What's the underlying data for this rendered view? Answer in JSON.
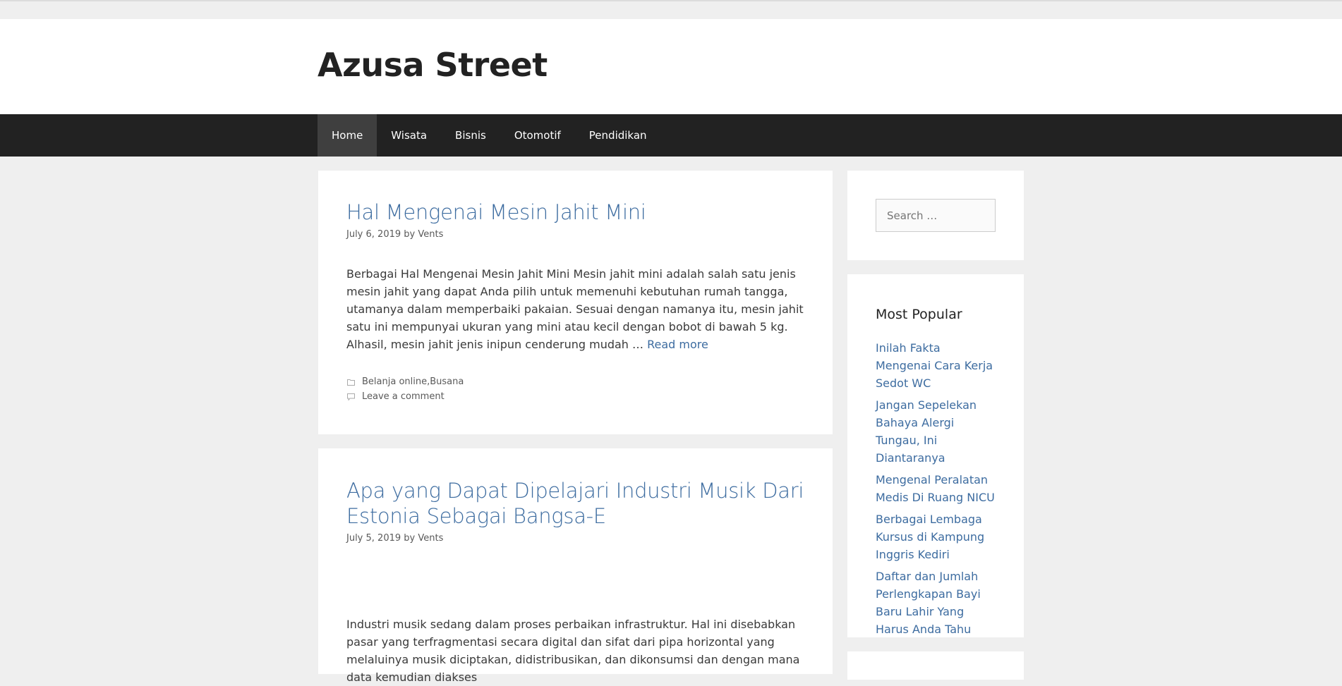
{
  "site": {
    "title": "Azusa Street"
  },
  "nav": {
    "items": [
      {
        "label": "Home"
      },
      {
        "label": "Wisata"
      },
      {
        "label": "Bisnis"
      },
      {
        "label": "Otomotif"
      },
      {
        "label": "Pendidikan"
      }
    ]
  },
  "posts": [
    {
      "title": "Hal Mengenai Mesin Jahit Mini",
      "date": "July 6, 2019",
      "by": "by",
      "author": "Vents",
      "summary": "Berbagai Hal Mengenai Mesin Jahit Mini Mesin jahit mini adalah salah satu jenis mesin jahit yang dapat Anda pilih untuk memenuhi kebutuhan rumah tangga, utamanya dalam memperbaiki pakaian. Sesuai dengan namanya itu, mesin jahit satu ini mempunyai ukuran yang mini atau kecil dengan bobot di bawah 5 kg. Alhasil, mesin jahit jenis inipun cenderung mudah …",
      "read_more": "Read more",
      "categories": [
        "Belanja online",
        "Busana"
      ],
      "category_separator": ", ",
      "comment_link": "Leave a comment"
    },
    {
      "title": "Apa yang Dapat Dipelajari Industri Musik Dari Estonia Sebagai Bangsa-E",
      "date": "July 5, 2019",
      "by": "by",
      "author": "Vents",
      "summary": "Industri musik sedang dalam proses perbaikan infrastruktur. Hal ini disebabkan pasar yang terfragmentasi secara digital dan sifat dari pipa horizontal yang melaluinya musik diciptakan, didistribusikan, dan dikonsumsi dan dengan mana data kemudian diakses"
    }
  ],
  "sidebar": {
    "search": {
      "placeholder": "Search …"
    },
    "popular": {
      "title": "Most Popular",
      "items": [
        "Inilah Fakta Mengenai Cara Kerja Sedot WC",
        "Jangan Sepelekan Bahaya Alergi Tungau, Ini Diantaranya",
        "Mengenal Peralatan Medis Di Ruang NICU",
        "Berbagai Lembaga Kursus di Kampung Inggris Kediri",
        "Daftar dan Jumlah Perlengkapan Bayi Baru Lahir Yang Harus Anda Tahu"
      ]
    }
  },
  "icons": {
    "category": "folder-icon",
    "comment": "comment-icon"
  },
  "colors": {
    "link": "#3d6ca0",
    "nav_bg": "#222222",
    "nav_active": "#3f3f3f",
    "page_bg": "#efefef"
  }
}
